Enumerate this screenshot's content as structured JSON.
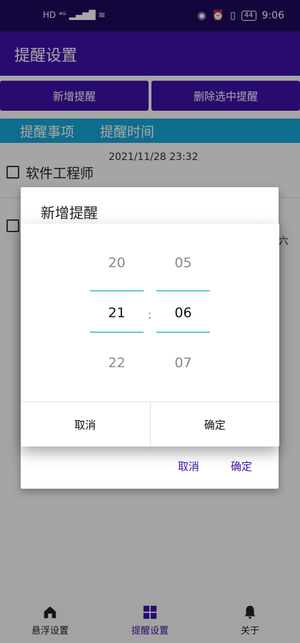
{
  "status": {
    "left": "HD ⁴ᴳ",
    "time": "9:06",
    "battery": "44"
  },
  "app": {
    "title": "提醒设置"
  },
  "actions": {
    "add": "新增提醒",
    "delete_selected": "删除选中提醒"
  },
  "table_header": {
    "item": "提醒事项",
    "time": "提醒时间"
  },
  "list": [
    {
      "label": "软件工程师",
      "time": "2021/11/28  23:32"
    },
    {
      "label": "",
      "time": "六"
    }
  ],
  "dialog": {
    "title": "新增提醒",
    "cancel": "取消",
    "confirm": "确定"
  },
  "time_picker": {
    "hours": [
      "20",
      "21",
      "22"
    ],
    "minutes": [
      "05",
      "06",
      "07"
    ],
    "separator": ":",
    "cancel": "取消",
    "confirm": "确定"
  },
  "nav": [
    {
      "label": "悬浮设置",
      "icon": "home-icon"
    },
    {
      "label": "提醒设置",
      "icon": "grid-icon"
    },
    {
      "label": "关于",
      "icon": "bell-icon"
    }
  ],
  "colors": {
    "primary": "#3f10a8",
    "header": "#18a8d6",
    "accent": "#62ccd6"
  }
}
